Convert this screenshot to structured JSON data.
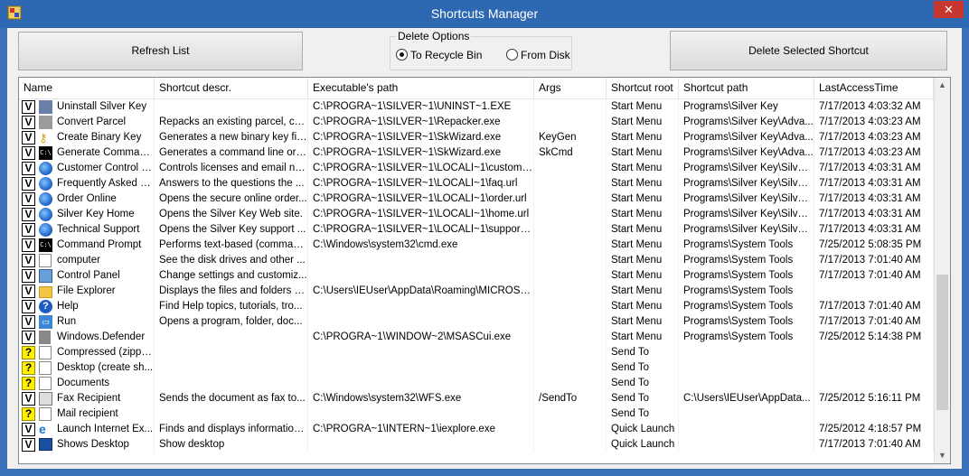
{
  "window": {
    "title": "Shortcuts Manager",
    "close_glyph": "✕"
  },
  "toolbar": {
    "refresh_label": "Refresh List",
    "delete_label": "Delete Selected Shortcut"
  },
  "delete_options": {
    "title": "Delete Options",
    "recycle_label": "To Recycle Bin",
    "disk_label": "From Disk",
    "selected": "To Recycle Bin"
  },
  "columns": [
    "Name",
    "Shortcut descr.",
    "Executable's path",
    "Args",
    "Shortcut root",
    "Shortcut path",
    "LastAccessTime"
  ],
  "rows": [
    {
      "check": "V",
      "icon": "uninstall-icon",
      "name": "Uninstall Silver Key",
      "descr": "",
      "path": "C:\\PROGRA~1\\SILVER~1\\UNINST~1.EXE",
      "args": "",
      "root": "Start Menu",
      "spath": "Programs\\Silver Key",
      "time": "7/17/2013  4:03:32 AM"
    },
    {
      "check": "V",
      "icon": "parcel-icon",
      "name": "Convert Parcel",
      "descr": "Repacks an existing parcel, co...",
      "path": "C:\\PROGRA~1\\SILVER~1\\Repacker.exe",
      "args": "",
      "root": "Start Menu",
      "spath": "Programs\\Silver Key\\Adva...",
      "time": "7/17/2013  4:03:23 AM"
    },
    {
      "check": "V",
      "icon": "key-icon",
      "name": "Create Binary Key",
      "descr": "Generates a new binary key file.",
      "path": "C:\\PROGRA~1\\SILVER~1\\SkWizard.exe",
      "args": "KeyGen",
      "root": "Start Menu",
      "spath": "Programs\\Silver Key\\Adva...",
      "time": "7/17/2013  4:03:23 AM"
    },
    {
      "check": "V",
      "icon": "cmd-icon",
      "name": "Generate Command...",
      "descr": "Generates a command line or ...",
      "path": "C:\\PROGRA~1\\SILVER~1\\SkWizard.exe",
      "args": "SkCmd",
      "root": "Start Menu",
      "spath": "Programs\\Silver Key\\Adva...",
      "time": "7/17/2013  4:03:23 AM"
    },
    {
      "check": "V",
      "icon": "globe-icon",
      "name": "Customer Control P...",
      "descr": "Controls licenses and email no...",
      "path": "C:\\PROGRA~1\\SILVER~1\\LOCALI~1\\customer...",
      "args": "",
      "root": "Start Menu",
      "spath": "Programs\\Silver Key\\Silver...",
      "time": "7/17/2013  4:03:31 AM"
    },
    {
      "check": "V",
      "icon": "globe-icon",
      "name": "Frequently Asked Q...",
      "descr": "Answers to the questions the ...",
      "path": "C:\\PROGRA~1\\SILVER~1\\LOCALI~1\\faq.url",
      "args": "",
      "root": "Start Menu",
      "spath": "Programs\\Silver Key\\Silver...",
      "time": "7/17/2013  4:03:31 AM"
    },
    {
      "check": "V",
      "icon": "globe-icon",
      "name": "Order Online",
      "descr": "Opens the secure online order...",
      "path": "C:\\PROGRA~1\\SILVER~1\\LOCALI~1\\order.url",
      "args": "",
      "root": "Start Menu",
      "spath": "Programs\\Silver Key\\Silver...",
      "time": "7/17/2013  4:03:31 AM"
    },
    {
      "check": "V",
      "icon": "globe-icon",
      "name": "Silver Key Home",
      "descr": "Opens the Silver Key Web site.",
      "path": "C:\\PROGRA~1\\SILVER~1\\LOCALI~1\\home.url",
      "args": "",
      "root": "Start Menu",
      "spath": "Programs\\Silver Key\\Silver...",
      "time": "7/17/2013  4:03:31 AM"
    },
    {
      "check": "V",
      "icon": "globe-icon",
      "name": "Technical Support",
      "descr": "Opens the Silver Key support ...",
      "path": "C:\\PROGRA~1\\SILVER~1\\LOCALI~1\\support.url",
      "args": "",
      "root": "Start Menu",
      "spath": "Programs\\Silver Key\\Silver...",
      "time": "7/17/2013  4:03:31 AM"
    },
    {
      "check": "V",
      "icon": "cmd-icon",
      "name": "Command Prompt",
      "descr": "Performs text-based (comman...",
      "path": "C:\\Windows\\system32\\cmd.exe",
      "args": "",
      "root": "Start Menu",
      "spath": "Programs\\System Tools",
      "time": "7/25/2012  5:08:35 PM"
    },
    {
      "check": "V",
      "icon": "blank-icon",
      "name": "computer",
      "descr": "See the disk drives and other ...",
      "path": "",
      "args": "",
      "root": "Start Menu",
      "spath": "Programs\\System Tools",
      "time": "7/17/2013  7:01:40 AM"
    },
    {
      "check": "V",
      "icon": "control-panel-icon",
      "name": "Control Panel",
      "descr": "Change settings and customiz...",
      "path": "",
      "args": "",
      "root": "Start Menu",
      "spath": "Programs\\System Tools",
      "time": "7/17/2013  7:01:40 AM"
    },
    {
      "check": "V",
      "icon": "folder-icon",
      "name": "File Explorer",
      "descr": "Displays the files and folders o...",
      "path": "C:\\Users\\IEUser\\AppData\\Roaming\\MICROS~...",
      "args": "",
      "root": "Start Menu",
      "spath": "Programs\\System Tools",
      "time": ""
    },
    {
      "check": "V",
      "icon": "help-icon",
      "name": "Help",
      "descr": "Find Help topics, tutorials, tro...",
      "path": "",
      "args": "",
      "root": "Start Menu",
      "spath": "Programs\\System Tools",
      "time": "7/17/2013  7:01:40 AM"
    },
    {
      "check": "V",
      "icon": "run-icon",
      "name": "Run",
      "descr": "Opens a program, folder, doc...",
      "path": "",
      "args": "",
      "root": "Start Menu",
      "spath": "Programs\\System Tools",
      "time": "7/17/2013  7:01:40 AM"
    },
    {
      "check": "V",
      "icon": "defender-icon",
      "name": "Windows.Defender",
      "descr": "",
      "path": "C:\\PROGRA~1\\WINDOW~2\\MSASCui.exe",
      "args": "",
      "root": "Start Menu",
      "spath": "Programs\\System Tools",
      "time": "7/25/2012  5:14:38 PM"
    },
    {
      "check": "?",
      "icon": "blank-icon",
      "name": "Compressed (zippe...",
      "descr": "",
      "path": "",
      "args": "",
      "root": "Send To",
      "spath": "",
      "time": ""
    },
    {
      "check": "?",
      "icon": "blank-icon",
      "name": "Desktop (create sh...",
      "descr": "",
      "path": "",
      "args": "",
      "root": "Send To",
      "spath": "",
      "time": ""
    },
    {
      "check": "?",
      "icon": "blank-icon",
      "name": "Documents",
      "descr": "",
      "path": "",
      "args": "",
      "root": "Send To",
      "spath": "",
      "time": ""
    },
    {
      "check": "V",
      "icon": "fax-icon",
      "name": "Fax Recipient",
      "descr": "Sends the document as fax to...",
      "path": "C:\\Windows\\system32\\WFS.exe",
      "args": "/SendTo",
      "root": "Send To",
      "spath": "C:\\Users\\IEUser\\AppData...",
      "time": "7/25/2012  5:16:11 PM"
    },
    {
      "check": "?",
      "icon": "blank-icon",
      "name": "Mail recipient",
      "descr": "",
      "path": "",
      "args": "",
      "root": "Send To",
      "spath": "",
      "time": ""
    },
    {
      "check": "V",
      "icon": "ie-icon",
      "name": "Launch Internet Ex...",
      "descr": "Finds and displays information...",
      "path": "C:\\PROGRA~1\\INTERN~1\\iexplore.exe",
      "args": "",
      "root": "Quick Launch",
      "spath": "",
      "time": "7/25/2012  4:18:57 PM"
    },
    {
      "check": "V",
      "icon": "desktop-icon",
      "name": "Shows Desktop",
      "descr": "Show desktop",
      "path": "",
      "args": "",
      "root": "Quick Launch",
      "spath": "",
      "time": "7/17/2013  7:01:40 AM"
    }
  ]
}
